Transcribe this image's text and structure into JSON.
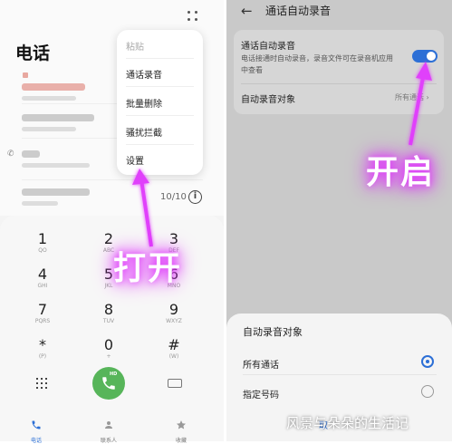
{
  "left_screen": {
    "title": "电话",
    "menu": {
      "items": [
        {
          "label": "粘贴",
          "dim": true
        },
        {
          "label": "通话录音",
          "dim": false
        },
        {
          "label": "批量删除",
          "dim": false
        },
        {
          "label": "骚扰拦截",
          "dim": false
        },
        {
          "label": "设置",
          "dim": false
        }
      ]
    },
    "call_count": "10/10",
    "keypad": [
      {
        "digit": "1",
        "letters": "QO"
      },
      {
        "digit": "2",
        "letters": "ABC"
      },
      {
        "digit": "3",
        "letters": "DEF"
      },
      {
        "digit": "4",
        "letters": "GHI"
      },
      {
        "digit": "5",
        "letters": "JKL"
      },
      {
        "digit": "6",
        "letters": "MNO"
      },
      {
        "digit": "7",
        "letters": "PQRS"
      },
      {
        "digit": "8",
        "letters": "TUV"
      },
      {
        "digit": "9",
        "letters": "WXYZ"
      },
      {
        "digit": "*",
        "letters": "(P)"
      },
      {
        "digit": "0",
        "letters": "+"
      },
      {
        "digit": "#",
        "letters": "(W)"
      }
    ],
    "call_badge": "HD",
    "bottom_nav": [
      {
        "label": "电话",
        "icon": "phone-icon",
        "active": true
      },
      {
        "label": "联系人",
        "icon": "contacts-icon",
        "active": false
      },
      {
        "label": "收藏",
        "icon": "star-icon",
        "active": false
      }
    ],
    "overlay_label": "打开"
  },
  "right_screen": {
    "title": "通话自动录音",
    "auto_record": {
      "label": "通话自动录音",
      "description": "电话接通时自动录音，录音文件可在录音机应用中查看",
      "enabled": true
    },
    "record_target": {
      "label": "自动录音对象",
      "value": "所有通话"
    },
    "overlay_label": "开启",
    "sheet": {
      "title": "自动录音对象",
      "options": [
        {
          "label": "所有通话",
          "selected": true
        },
        {
          "label": "指定号码",
          "selected": false
        }
      ],
      "cancel_fragment": "取"
    },
    "watermark": "风景与朵朵的生活记"
  },
  "colors": {
    "accent_blue": "#2c6fd6",
    "call_green": "#57b55a",
    "overlay_glow": "#e040fb"
  }
}
